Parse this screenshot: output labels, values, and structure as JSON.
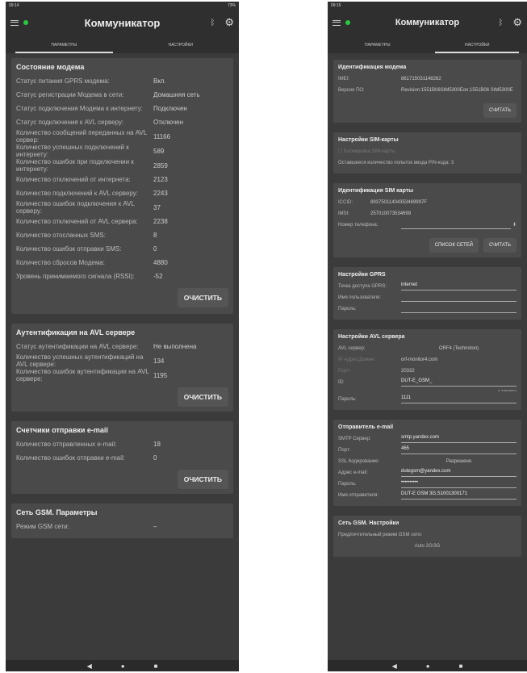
{
  "left": {
    "status": {
      "time": "09:14",
      "right": "73%"
    },
    "title": "Коммуникатор",
    "tabs": [
      "ПАРАМЕТРЫ",
      "НАСТРОЙКИ"
    ],
    "modem": {
      "title": "Состояние модема",
      "rows": [
        {
          "l": "Статус питания GPRS модема:",
          "v": "Вкл."
        },
        {
          "l": "Статус регистрации Модема в сети:",
          "v": "Домашняя сеть"
        },
        {
          "l": "Статус подключения Модема к интернету:",
          "v": "Подключен"
        },
        {
          "l": "Статус подключения к AVL серверу:",
          "v": "Отключен"
        },
        {
          "l": "Количество сообщений переданных на AVL сервер:",
          "v": "11166"
        },
        {
          "l": "Количество успешных подключений к интернету:",
          "v": "589"
        },
        {
          "l": "Количество ошибок при подключении к интернету:",
          "v": "2859"
        },
        {
          "l": "Количество отключений от интернета:",
          "v": "2123"
        },
        {
          "l": "Количество подключений к AVL серверу:",
          "v": "2243"
        },
        {
          "l": "Количество ошибок подключения к AVL серверу:",
          "v": "37"
        },
        {
          "l": "Количество отключений от AVL сервера:",
          "v": "2238"
        },
        {
          "l": "Количество отосланных SMS:",
          "v": "8"
        },
        {
          "l": "Количество ошибок отправки SMS:",
          "v": "0"
        },
        {
          "l": "Количество сбросов Модема:",
          "v": "4880"
        },
        {
          "l": "Уровень принимаемого сигнала (RSSI):",
          "v": "-52"
        }
      ],
      "btn": "ОЧИСТИТЬ"
    },
    "auth": {
      "title": "Аутентификация на AVL сервере",
      "rows": [
        {
          "l": "Статус аутентификации на AVL сервере:",
          "v": "Не выполнена"
        },
        {
          "l": "Количество успешных аутентификаций на AVL сервере:",
          "v": "134"
        },
        {
          "l": "Количество ошибок аутентификации на AVL сервере:",
          "v": "1195"
        }
      ],
      "btn": "ОЧИСТИТЬ"
    },
    "email": {
      "title": "Счетчики отправки e-mail",
      "rows": [
        {
          "l": "Количество отправленных e-mail:",
          "v": "18"
        },
        {
          "l": "Количество ошибок отправки e-mail:",
          "v": "0"
        }
      ],
      "btn": "ОЧИСТИТЬ"
    },
    "gsm": {
      "title": "Сеть GSM. Параметры",
      "rows": [
        {
          "l": "Режим GSM сети:",
          "v": "–"
        }
      ]
    }
  },
  "right": {
    "status": {
      "time": "09:15"
    },
    "title": "Коммуникатор",
    "tabs": [
      "ПАРАМЕТРЫ",
      "НАСТРОЙКИ"
    ],
    "ident": {
      "title": "Идентификация модема",
      "imei_l": "IMEI:",
      "imei": "861715031148282",
      "ver_l": "Версия ПО:",
      "ver": "Revision:1551B06SIM5300Eon:1551B06 SIM5300E",
      "btn": "СЧИТАТЬ"
    },
    "sim": {
      "title": "Настройки SIM-карты",
      "lock": "Блокировка SIM-карты",
      "tries": "Оставшееся количество попыток ввода PIN-кода: 3"
    },
    "simid": {
      "title": "Идентификация SIM карты",
      "iccid_l": "ICCID:",
      "iccid": "89375011404353469997F",
      "imsi_l": "IMSI:",
      "imsi": "257010073534699",
      "phone_l": "Номер телефона:",
      "btn1": "СПИСОК СЕТЕЙ",
      "btn2": "СЧИТАТЬ"
    },
    "gprs": {
      "title": "Настройки GPRS",
      "apn_l": "Точка доступа GPRS:",
      "apn": "internet",
      "user_l": "Имя пользователя:",
      "pass_l": "Пароль:"
    },
    "avl": {
      "title": "Настройки AVL сервера",
      "srv_l": "AVL сервер:",
      "srv": "ORF4 (Technoton)",
      "ip_l": "IP Адрес/Домен:",
      "ip": "orf-monitor4.com",
      "port_l": "Порт:",
      "port": "20332",
      "id_l": "ID:",
      "id": "DUT-E_GSM_",
      "idhint": "Ст. 51001300171",
      "pass_l": "Пароль:",
      "pass": "1111"
    },
    "mail": {
      "title": "Отправитель e-mail",
      "smtp_l": "SMTP Сервер:",
      "smtp": "smtp.yandex.com",
      "port_l": "Порт:",
      "port": "465",
      "ssl_l": "SSL Кодирование:",
      "ssl": "Разрешено",
      "addr_l": "Адрес e-mail:",
      "addr": "dutegsm@yandex.com",
      "pass_l": "Пароль:",
      "pass": "••••••••••",
      "name_l": "Имя отправителя:",
      "name": "DUT-E GSM 3G.S1001300171"
    },
    "gsm": {
      "title": "Сеть GSM. Настройки",
      "pref_l": "Предпочтительный режим GSM сети:",
      "pref": "Auto 2G/3G"
    }
  }
}
